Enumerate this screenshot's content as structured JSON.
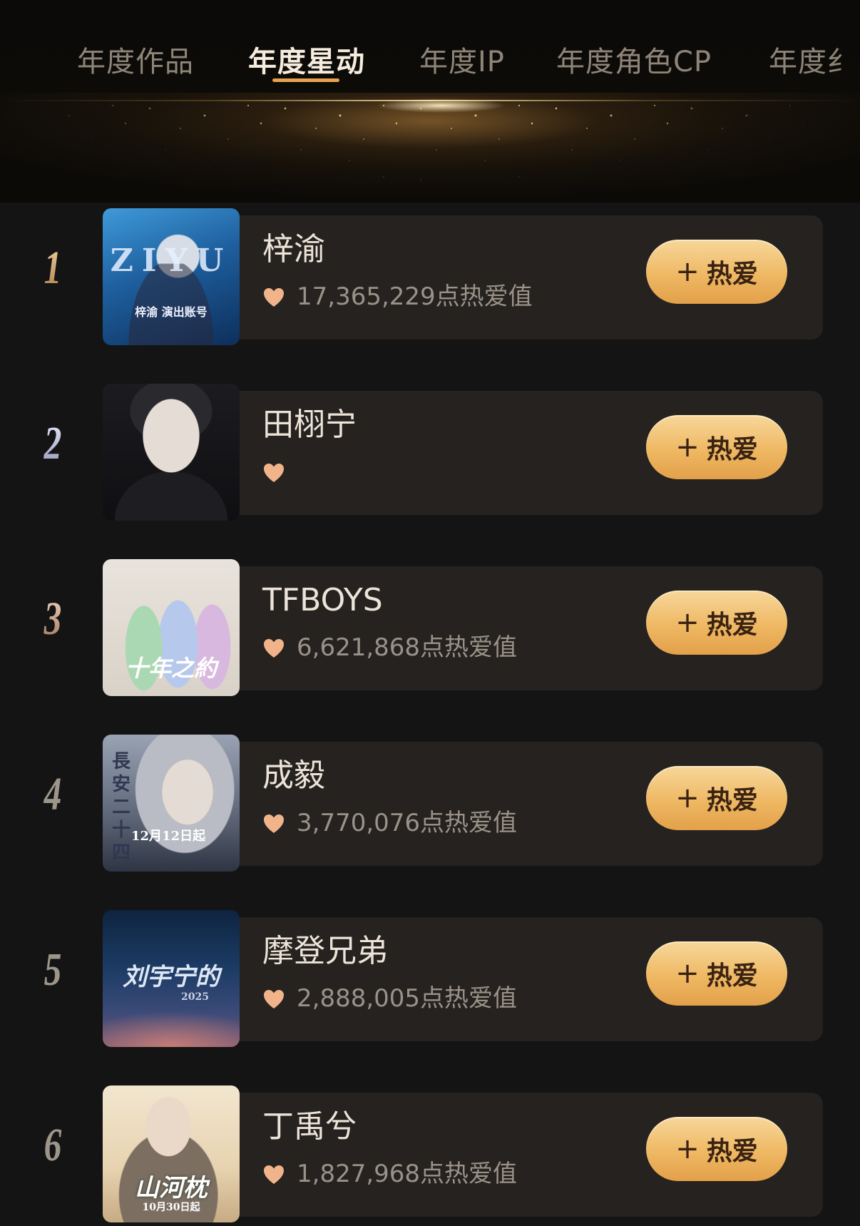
{
  "tabs": [
    {
      "label": "年度作品",
      "active": false
    },
    {
      "label": "年度星动",
      "active": true
    },
    {
      "label": "年度IP",
      "active": false
    },
    {
      "label": "年度角色CP",
      "active": false
    },
    {
      "label": "年度纟",
      "active": false
    }
  ],
  "colors": {
    "accent": "#e8a24e",
    "button_gradient_top": "#f7d79b",
    "button_gradient_bottom": "#e3a04a",
    "heart": "#f1b48a",
    "card_bg": "#25221f",
    "page_bg": "#141414"
  },
  "ranking": [
    {
      "rank": "1",
      "name": "梓渝",
      "score": "17,365,229点热爱值",
      "button_label": "热爱",
      "thumb_caption_main": "ZIYU",
      "thumb_caption_sub": "梓渝 演出账号"
    },
    {
      "rank": "2",
      "name": "田栩宁",
      "score": "",
      "button_label": "热爱",
      "thumb_caption_main": "",
      "thumb_caption_sub": ""
    },
    {
      "rank": "3",
      "name": "TFBOYS",
      "score": "6,621,868点热爱值",
      "button_label": "热爱",
      "thumb_caption_main": "十年之約",
      "thumb_caption_sub": ""
    },
    {
      "rank": "4",
      "name": "成毅",
      "score": "3,770,076点热爱值",
      "button_label": "热爱",
      "thumb_caption_main": "長安二十四計",
      "thumb_caption_sub": "12月12日起"
    },
    {
      "rank": "5",
      "name": "摩登兄弟",
      "score": "2,888,005点热爱值",
      "button_label": "热爱",
      "thumb_caption_main": "刘宇宁的",
      "thumb_caption_sub": "2025"
    },
    {
      "rank": "6",
      "name": "丁禹兮",
      "score": "1,827,968点热爱值",
      "button_label": "热爱",
      "thumb_caption_main": "山河枕",
      "thumb_caption_sub": "10月30日起"
    }
  ]
}
